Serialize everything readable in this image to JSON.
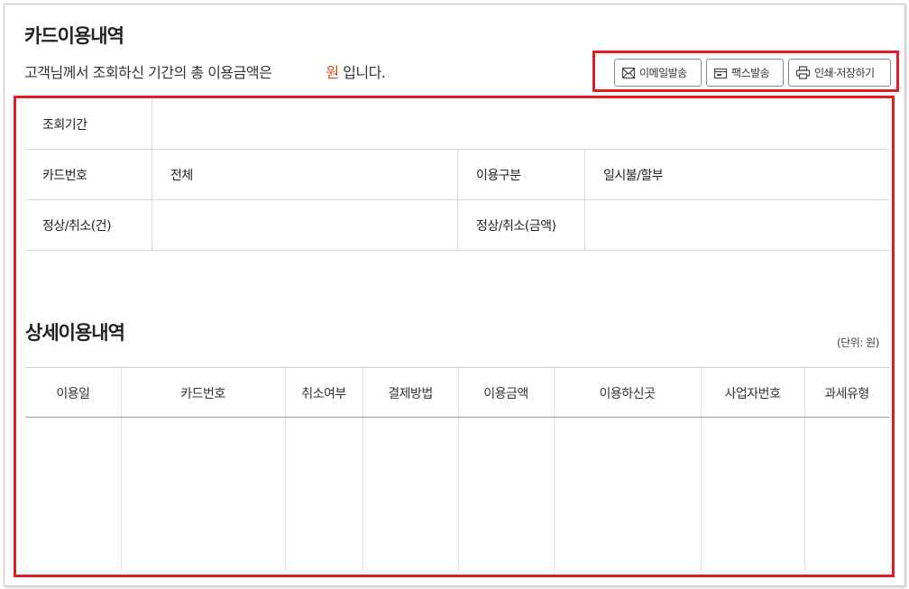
{
  "page": {
    "title": "카드이용내역",
    "summary_text": "고객님께서 조회하신 기간의 총 이용금액은",
    "summary_unit": "원",
    "summary_suffix": " 입니다."
  },
  "toolbar": {
    "email_label": "이메일발송",
    "fax_label": "팩스발송",
    "print_label": "인쇄·저장하기"
  },
  "info_table": {
    "period_label": "조회기간",
    "period_value": "",
    "card_label": "카드번호",
    "card_value": "전체",
    "usage_type_label": "이용구분",
    "usage_type_value": "일시불/할부",
    "count_label": "정상/취소(건)",
    "count_value": "",
    "amount_label": "정상/취소(금액)",
    "amount_value": ""
  },
  "detail": {
    "title": "상세이용내역",
    "unit_note": "(단위: 원)",
    "columns": [
      "이용일",
      "카드번호",
      "취소여부",
      "결제방법",
      "이용금액",
      "이용하신곳",
      "사업자번호",
      "과세유형"
    ]
  },
  "colors": {
    "highlight": "#e31b23",
    "accent": "#d9480f"
  }
}
